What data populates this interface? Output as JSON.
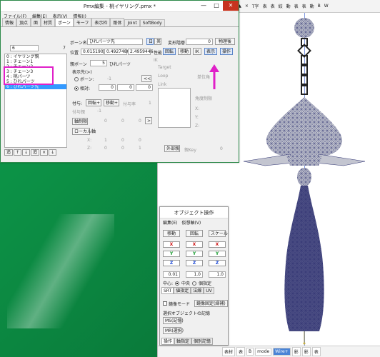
{
  "desktop": {
    "bg": "#0a9d4c"
  },
  "viewport": {
    "toolbar": [
      "選択",
      "頂",
      "面",
      "骨",
      "剛",
      "J",
      "範囲:",
      "■",
      "□",
      "▲",
      "×",
      "T字",
      "表",
      "表",
      "絞",
      "動",
      "表",
      "表",
      "動",
      "B",
      "W"
    ],
    "toolbar_active": "骨",
    "bottom_bar": [
      "表材",
      "表",
      "B",
      "mode",
      "Wire+",
      "影",
      "影",
      "表"
    ],
    "bottom_active": "Wire+"
  },
  "pmx": {
    "title": "Pmx編集 - 桃イヤリング.pmx *",
    "controls": [
      "—",
      "□",
      "✕"
    ],
    "menu": [
      "ファイル(F)",
      "編集(E)",
      "表示(V)",
      "情報(I)"
    ],
    "tabs": [
      "情報",
      "頂点",
      "面",
      "材質",
      "ボーン",
      "モーフ",
      "表示枠",
      "剛体",
      "Joint",
      "SoftBody"
    ],
    "active_tab": "ボーン",
    "list_index": "6",
    "list_count": "7",
    "bones": [
      "0 : イヤリング親",
      "1 : チェーン1",
      "2 : チェーン2",
      "3 : チェーン3",
      "4 : 桃パーツ",
      "5 : ひれパーツ",
      "6 : ひれパーツ先"
    ],
    "selected_bone": "6 : ひれパーツ先",
    "list_buttons": [
      "追",
      "↑",
      "↓",
      "追",
      "×",
      "↓"
    ],
    "bone_name_label": "ボーン名",
    "bone_name": "ひれパーツ先",
    "lang_jp": "日",
    "lang_en": "英",
    "transform_level_label": "変形階層",
    "transform_level": "0",
    "physics_after": "物理後",
    "position_label": "位置",
    "pos": [
      "0.0151901",
      "0.4927480",
      "2.4959446"
    ],
    "perf_label": "性能",
    "perf_buttons": [
      "回転",
      "移動",
      "IK",
      "表示",
      "操作"
    ],
    "parent_label": "親ボーン",
    "parent_index": "5",
    "parent_name": "ひれパーツ",
    "ik_label": "IK",
    "target_label": "Target",
    "loop_label": "Loop",
    "unit_angle_label": "単位角",
    "link_label": "Link",
    "angle_limit_label": "角度制限",
    "display_target_label": "表示先(>)",
    "radio_bone": "ボーン:",
    "radio_bone_value": "-1",
    "radio_offset": "相対:",
    "offset": [
      "0",
      "0",
      "0"
    ],
    "nav_btn": "<<",
    "grant_label": "付与:",
    "grant_rot": "回転+",
    "grant_move": "移動+",
    "grant_rate_label": "付与率",
    "grant_rate": "1",
    "grant_parent_label": "付与親",
    "grant_parent": "-1",
    "fixed_axis": "軸制限",
    "fixed_vals": [
      "0",
      "0",
      "0"
    ],
    "local_axis": "ローカル軸",
    "x_label": "X:",
    "z_label": "Z:",
    "local_x": [
      "1",
      "0",
      "0"
    ],
    "local_z": [
      "0",
      "0",
      "1"
    ],
    "xyz": [
      "X:",
      "Y:",
      "Z:"
    ],
    "external_parent": "外部親",
    "key_label": "親Key",
    "key_value": "0"
  },
  "obj": {
    "title": "オブジェクト操作",
    "menu": [
      "編集(E)",
      "仮想軸(V)"
    ],
    "modes": [
      "移動",
      "回転",
      "スケール"
    ],
    "axes": [
      "X",
      "Y",
      "Z"
    ],
    "values": [
      "0.01",
      "1.0",
      "1.0"
    ],
    "center_label": "中心:",
    "center_opt1": "中央",
    "center_opt2": "個指定",
    "tabs": [
      "SRT",
      "値指定",
      "法線",
      "UV"
    ],
    "mirror_mode": "鏡像モード",
    "mirror_fixed": "鏡像固定(縁補)",
    "memory_label": "選択オブジェクトの記憶",
    "ms_memory": "MS(記憶)",
    "mr_recall": "MR(選択)",
    "bottom_tabs": [
      "操作",
      "軸指定",
      "個別記憶"
    ]
  }
}
